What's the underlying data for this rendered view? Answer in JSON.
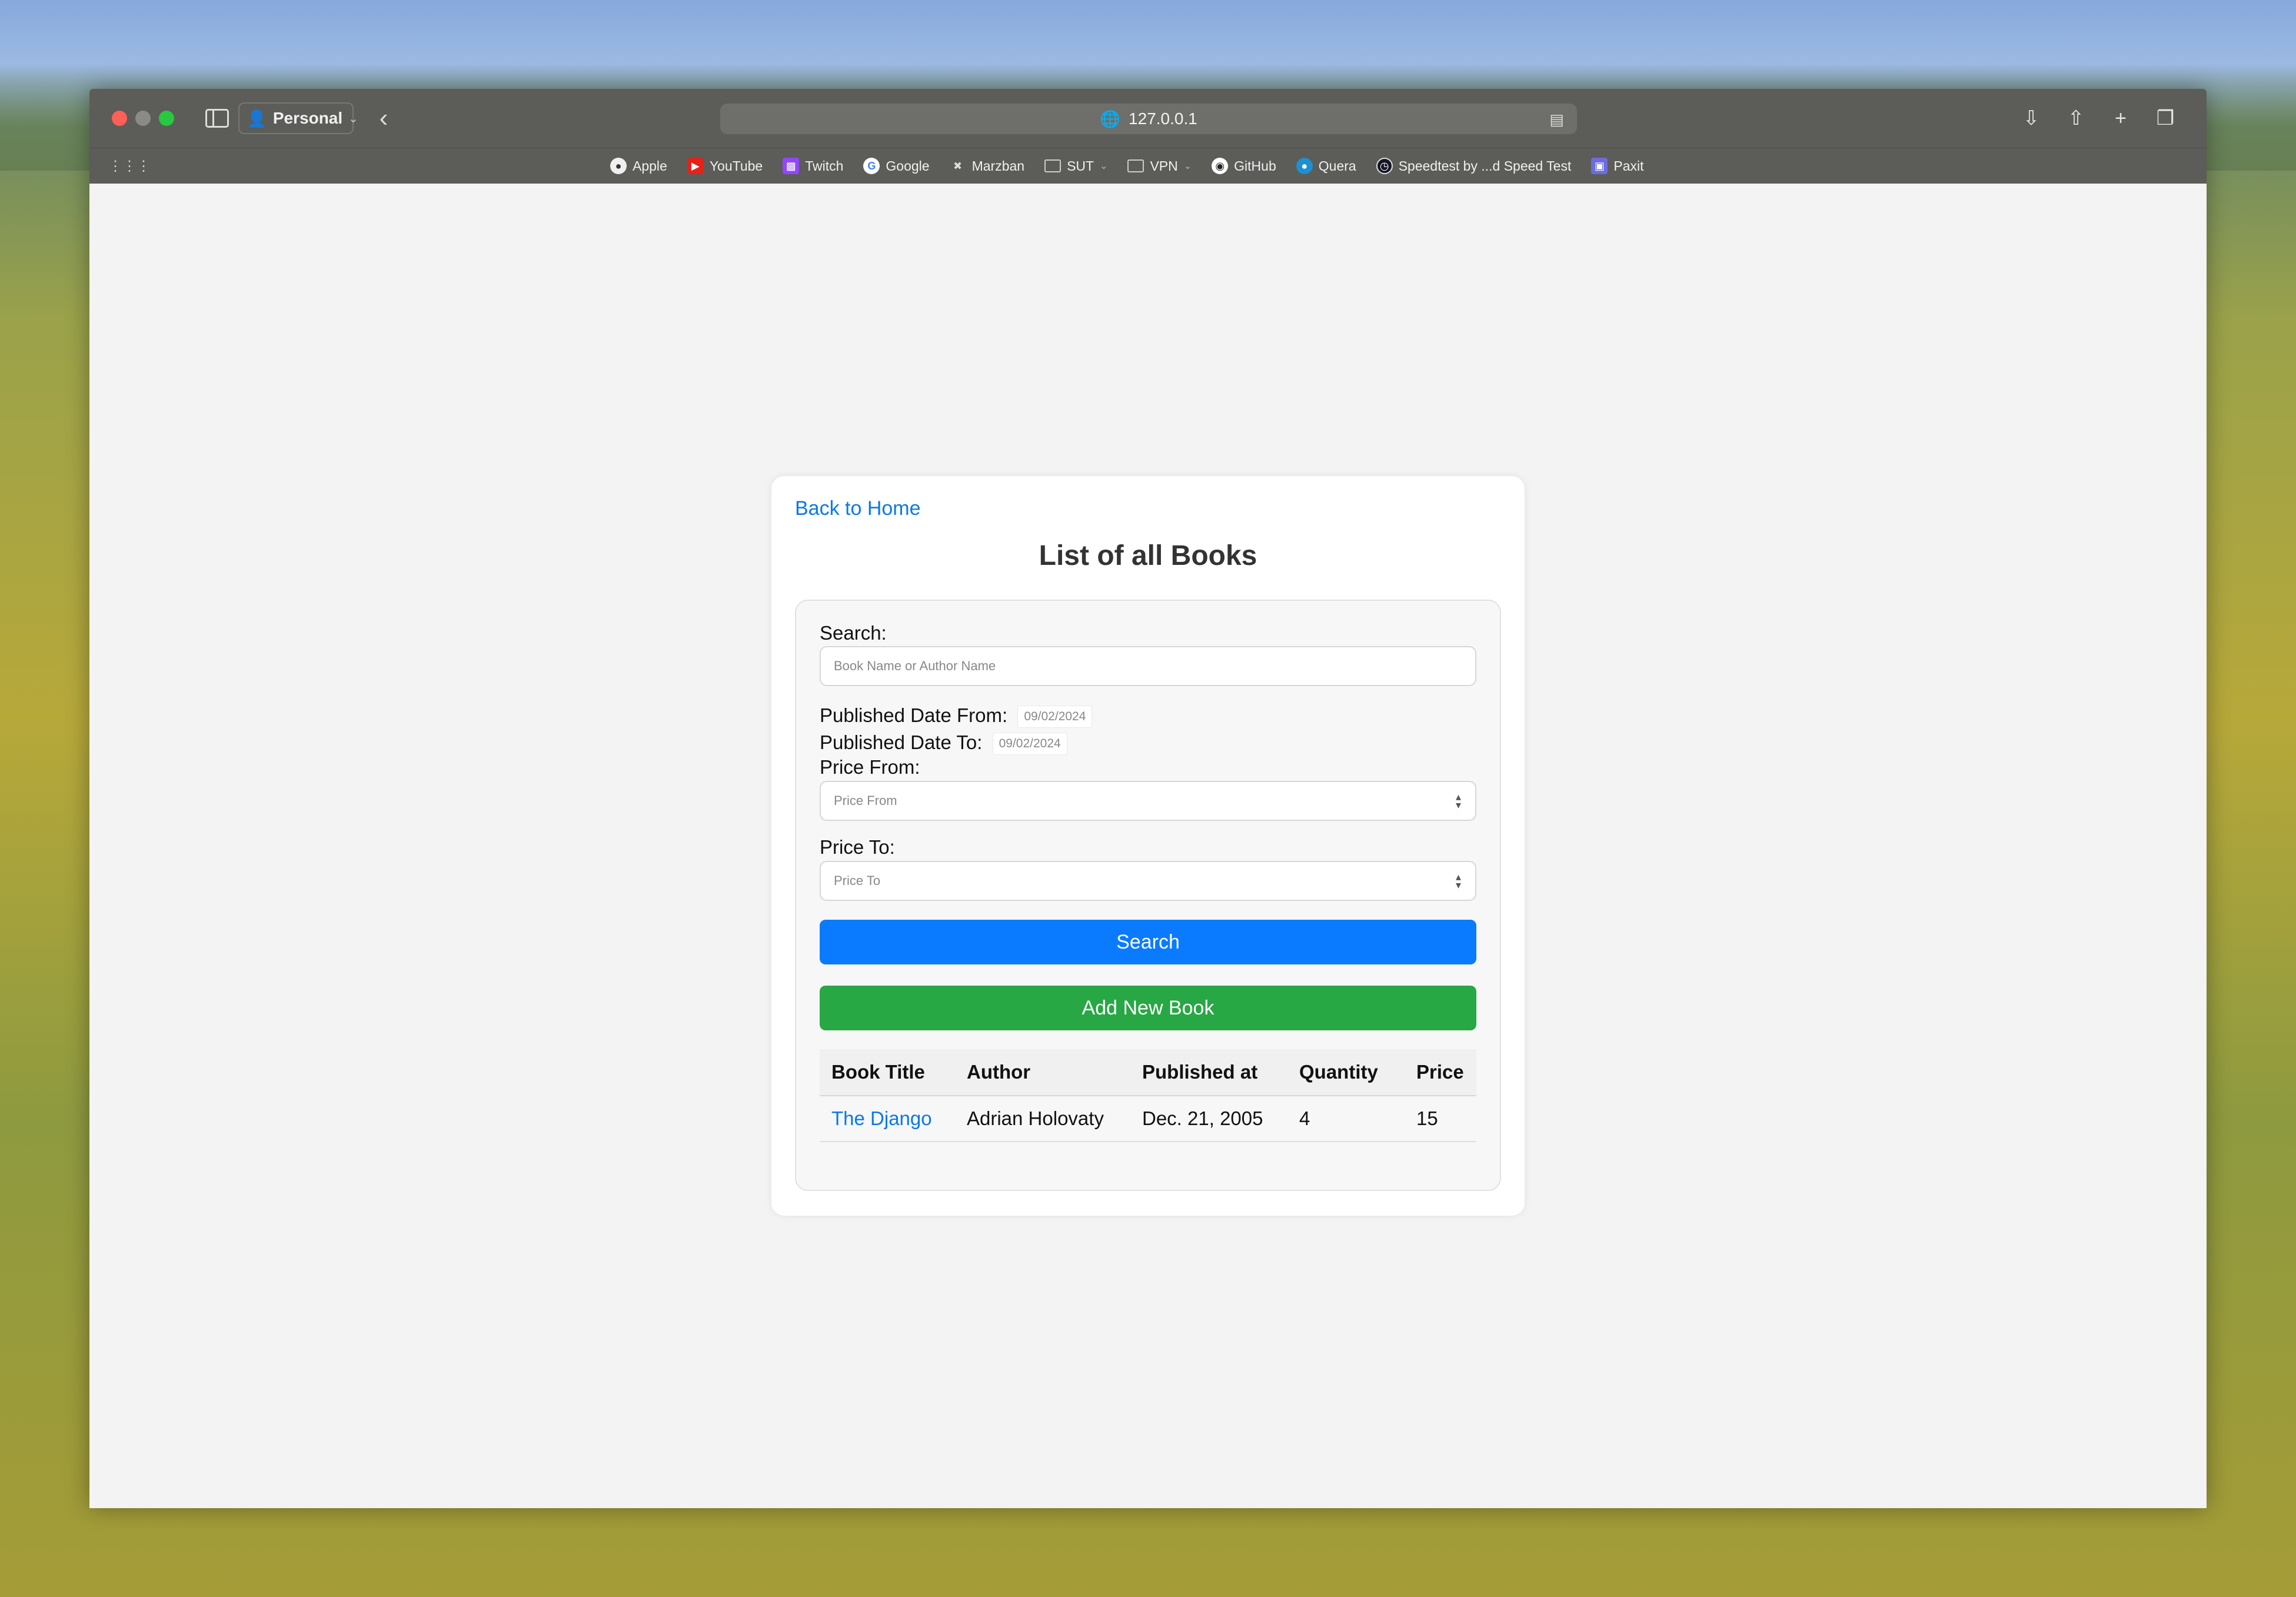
{
  "browser": {
    "profile": "Personal",
    "url": "127.0.0.1",
    "bookmarks": [
      {
        "label": "Apple"
      },
      {
        "label": "YouTube"
      },
      {
        "label": "Twitch"
      },
      {
        "label": "Google"
      },
      {
        "label": "Marzban"
      },
      {
        "label": "SUT"
      },
      {
        "label": "VPN"
      },
      {
        "label": "GitHub"
      },
      {
        "label": "Quera"
      },
      {
        "label": "Speedtest by ...d Speed Test"
      },
      {
        "label": "Paxit"
      }
    ]
  },
  "page": {
    "back_link": "Back to Home",
    "title": "List of all Books",
    "form": {
      "search_label": "Search:",
      "search_placeholder": "Book Name or Author Name",
      "date_from_label": "Published Date From:",
      "date_from_value": "09/02/2024",
      "date_to_label": "Published Date To:",
      "date_to_value": "09/02/2024",
      "price_from_label": "Price From:",
      "price_from_placeholder": "Price From",
      "price_to_label": "Price To:",
      "price_to_placeholder": "Price To",
      "search_button": "Search",
      "add_button": "Add New Book"
    },
    "table": {
      "headers": [
        "Book Title",
        "Author",
        "Published at",
        "Quantity",
        "Price"
      ],
      "rows": [
        [
          "The Django",
          "Adrian Holovaty",
          "Dec. 21, 2005",
          "4",
          "15"
        ]
      ]
    }
  }
}
